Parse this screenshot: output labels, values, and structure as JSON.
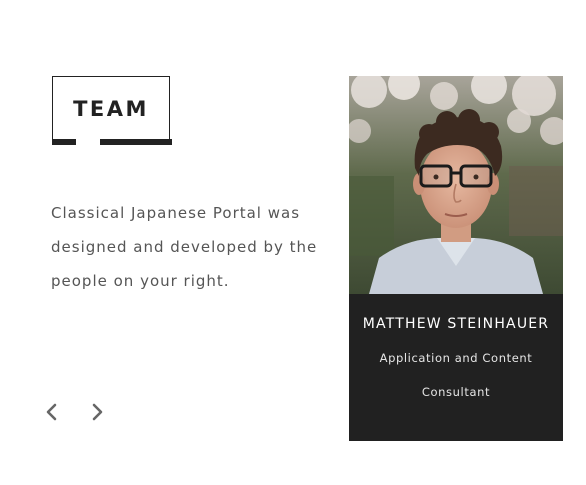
{
  "section": {
    "title": "TEAM",
    "description": "Classical Japanese Portal was designed and developed by the people on your right."
  },
  "navigation": {
    "prev_icon": "chevron-left-icon",
    "next_icon": "chevron-right-icon"
  },
  "member": {
    "name": "MATTHEW STEINHAUER",
    "role": "Application and Content Consultant"
  },
  "colors": {
    "card_background": "#212121",
    "title_border": "#222222",
    "text": "#555555",
    "arrow": "#666666"
  }
}
